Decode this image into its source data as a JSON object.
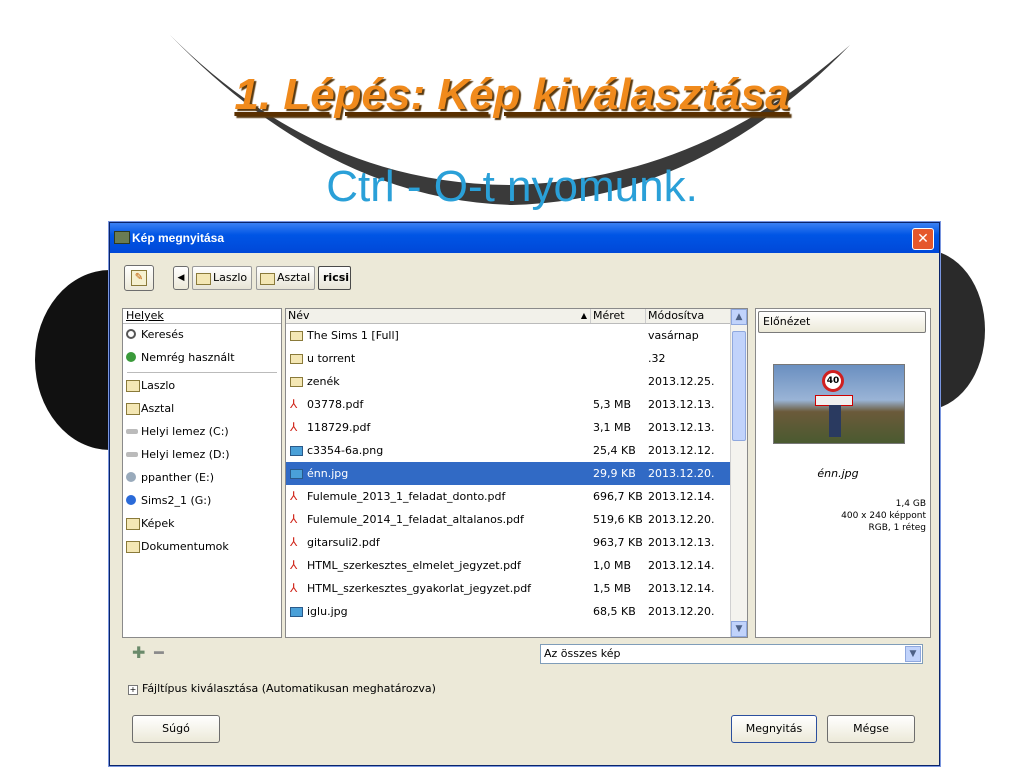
{
  "slide": {
    "title": "1. Lépés: Kép kiválasztása",
    "subtitle": "Ctrl - O-t nyomunk."
  },
  "dialog": {
    "title": "Kép megnyitása",
    "breadcrumbs": [
      "Laszlo",
      "Asztal",
      "ricsi"
    ],
    "places": {
      "header": "Helyek",
      "items": [
        {
          "label": "Keresés",
          "icon": "search-icon"
        },
        {
          "label": "Nemrég használt",
          "icon": "recent-icon"
        },
        {
          "label": "Laszlo",
          "icon": "folder-icon"
        },
        {
          "label": "Asztal",
          "icon": "folder-icon"
        },
        {
          "label": "Helyi lemez (C:)",
          "icon": "drive-icon"
        },
        {
          "label": "Helyi lemez (D:)",
          "icon": "drive-icon"
        },
        {
          "label": "ppanther (E:)",
          "icon": "network-drive-icon"
        },
        {
          "label": "Sims2_1 (G:)",
          "icon": "cd-drive-icon"
        },
        {
          "label": "Képek",
          "icon": "folder-icon"
        },
        {
          "label": "Dokumentumok",
          "icon": "folder-icon"
        }
      ]
    },
    "files": {
      "columns": {
        "name": "Név",
        "size": "Méret",
        "modified": "Módosítva"
      },
      "rows": [
        {
          "name": "The Sims 1 [Full]",
          "size": "",
          "modified": "vasárnap",
          "type": "folder"
        },
        {
          "name": "u torrent",
          "size": "",
          "modified": ".32",
          "type": "folder"
        },
        {
          "name": "zenék",
          "size": "",
          "modified": "2013.12.25.",
          "type": "folder"
        },
        {
          "name": "03778.pdf",
          "size": "5,3 MB",
          "modified": "2013.12.13.",
          "type": "pdf"
        },
        {
          "name": "118729.pdf",
          "size": "3,1 MB",
          "modified": "2013.12.13.",
          "type": "pdf"
        },
        {
          "name": "c3354-6a.png",
          "size": "25,4 KB",
          "modified": "2013.12.12.",
          "type": "img"
        },
        {
          "name": "énn.jpg",
          "size": "29,9 KB",
          "modified": "2013.12.20.",
          "type": "img",
          "selected": true
        },
        {
          "name": "Fulemule_2013_1_feladat_donto.pdf",
          "size": "696,7 KB",
          "modified": "2013.12.14.",
          "type": "pdf"
        },
        {
          "name": "Fulemule_2014_1_feladat_altalanos.pdf",
          "size": "519,6 KB",
          "modified": "2013.12.20.",
          "type": "pdf"
        },
        {
          "name": "gitarsuli2.pdf",
          "size": "963,7 KB",
          "modified": "2013.12.13.",
          "type": "pdf"
        },
        {
          "name": "HTML_szerkesztes_elmelet_jegyzet.pdf",
          "size": "1,0 MB",
          "modified": "2013.12.14.",
          "type": "pdf"
        },
        {
          "name": "HTML_szerkesztes_gyakorlat_jegyzet.pdf",
          "size": "1,5 MB",
          "modified": "2013.12.14.",
          "type": "pdf"
        },
        {
          "name": "iglu.jpg",
          "size": "68,5 KB",
          "modified": "2013.12.20.",
          "type": "img"
        }
      ]
    },
    "preview": {
      "title": "Előnézet",
      "sign_text": "40",
      "filename": "énn.jpg",
      "size": "1,4 GB",
      "dimensions": "400 x 240 képpont",
      "color": "RGB, 1 réteg"
    },
    "filter": "Az összes kép",
    "filetype_label": "Fájltípus kiválasztása (Automatikusan meghatározva)",
    "buttons": {
      "help": "Súgó",
      "open": "Megnyitás",
      "cancel": "Mégse"
    }
  }
}
